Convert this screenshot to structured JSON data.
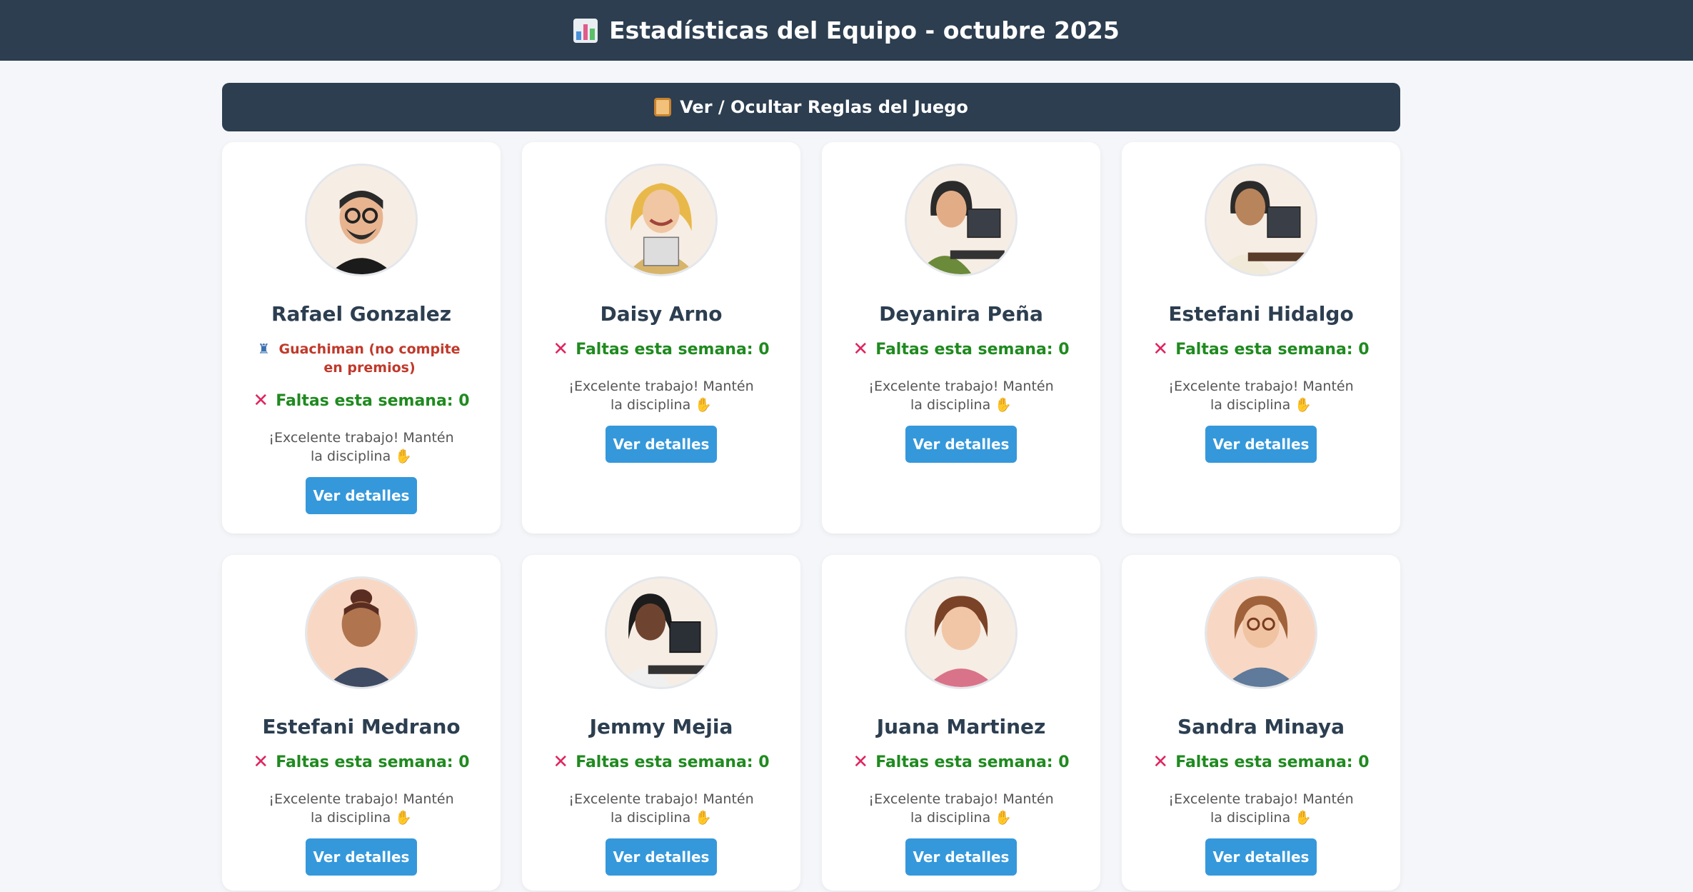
{
  "header": {
    "title": "Estadísticas del Equipo - octubre 2025",
    "icon": "bar-chart-icon"
  },
  "rules_toggle": {
    "label": "Ver / Ocultar Reglas del Juego",
    "icon": "scroll-icon"
  },
  "colors": {
    "header_bg": "#2c3e50",
    "button": "#3498db",
    "faltas": "#1f8a1f",
    "role": "#c0392b",
    "x_mark": "#e0245e"
  },
  "employees": [
    {
      "name": "Rafael Gonzalez",
      "role": "Guachiman (no compite en premios)",
      "faltas": "Faltas esta semana: 0",
      "message": "¡Excelente trabajo! Mantén la disciplina",
      "button": "Ver detalles"
    },
    {
      "name": "Daisy Arno",
      "faltas": "Faltas esta semana: 0",
      "message": "¡Excelente trabajo! Mantén la disciplina",
      "button": "Ver detalles"
    },
    {
      "name": "Deyanira Peña",
      "faltas": "Faltas esta semana: 0",
      "message": "¡Excelente trabajo! Mantén la disciplina",
      "button": "Ver detalles"
    },
    {
      "name": "Estefani Hidalgo",
      "faltas": "Faltas esta semana: 0",
      "message": "¡Excelente trabajo! Mantén la disciplina",
      "button": "Ver detalles"
    },
    {
      "name": "Estefani Medrano",
      "faltas": "Faltas esta semana: 0",
      "message": "¡Excelente trabajo! Mantén la disciplina",
      "button": "Ver detalles"
    },
    {
      "name": "Jemmy Mejia",
      "faltas": "Faltas esta semana: 0",
      "message": "¡Excelente trabajo! Mantén la disciplina",
      "button": "Ver detalles"
    },
    {
      "name": "Juana Martinez",
      "faltas": "Faltas esta semana: 0",
      "message": "¡Excelente trabajo! Mantén la disciplina",
      "button": "Ver detalles"
    },
    {
      "name": "Sandra Minaya",
      "faltas": "Faltas esta semana: 0",
      "message": "¡Excelente trabajo! Mantén la disciplina",
      "button": "Ver detalles"
    }
  ]
}
